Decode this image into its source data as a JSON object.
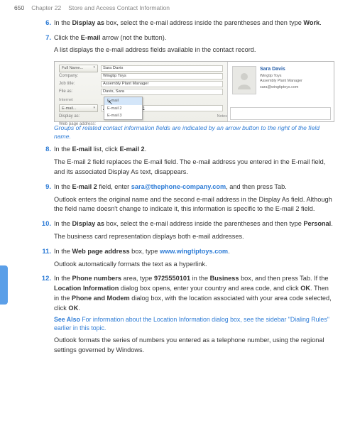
{
  "header": {
    "page": "650",
    "chapter": "Chapter 22",
    "title": "Store and Access Contact Information"
  },
  "steps": {
    "s6": {
      "num": "6.",
      "p1a": "In the ",
      "p1b": "Display as",
      "p1c": " box, select the e-mail address inside the parentheses and then type ",
      "p1d": "Work",
      "p1e": "."
    },
    "s7": {
      "num": "7.",
      "p1a": "Click the ",
      "p1b": "E-mail",
      "p1c": " arrow (not the button).",
      "p2": "A list displays the e-mail address fields available in the contact record."
    },
    "s8": {
      "num": "8.",
      "p1a": "In the ",
      "p1b": "E-mail",
      "p1c": " list, click ",
      "p1d": "E-mail 2",
      "p1e": ".",
      "p2": "The E-mail 2 field replaces the E-mail field. The e-mail address you entered in the E-mail field, and its associated Display As text, disappears."
    },
    "s9": {
      "num": "9.",
      "p1a": "In the ",
      "p1b": "E-mail 2",
      "p1c": " field, enter ",
      "p1d": "sara@thephone-company.com",
      "p1e": ", and then press Tab.",
      "p2": "Outlook enters the original name and the second e-mail address in the Display As field. Although the field name doesn't change to indicate it, this information is specific to the E-mail 2 field."
    },
    "s10": {
      "num": "10.",
      "p1a": "In the ",
      "p1b": "Display as",
      "p1c": " box, select the e-mail address inside the parentheses and then type ",
      "p1d": "Personal",
      "p1e": ".",
      "p2": "The business card representation displays both e-mail addresses."
    },
    "s11": {
      "num": "11.",
      "p1a": "In the ",
      "p1b": "Web page address",
      "p1c": " box, type ",
      "p1d": "www.wingtiptoys.com",
      "p1e": ".",
      "p2": "Outlook automatically formats the text as a hyperlink."
    },
    "s12": {
      "num": "12.",
      "p1a": "In the ",
      "p1b": "Phone numbers",
      "p1c": " area, type ",
      "p1d": "9725550101",
      "p1e": " in the ",
      "p1f": "Business",
      "p1g": " box, and then press Tab. If the ",
      "p1h": "Location Information",
      "p1i": " dialog box opens, enter your country and area code, and click ",
      "p1j": "OK",
      "p1k": ". Then in the ",
      "p1l": "Phone and Modem",
      "p1m": " dialog box, with the location associated with your area code selected, click ",
      "p1n": "OK",
      "p1o": ".",
      "seealso_label": "See Also",
      "seealso_text": "  For information about the Location Information dialog box, see the sidebar \"Dialing Rules\" earlier in this topic.",
      "p3": "Outlook formats the series of numbers you entered as a telephone number, using the regional settings governed by Windows."
    }
  },
  "caption": "Groups of related contact information fields are indicated by an arrow button to the right of the field name.",
  "figure": {
    "btn_fullname": "Full Name...",
    "val_fullname": "Sara Davis",
    "lbl_company": "Company:",
    "val_company": "Wingtip Toys",
    "lbl_jobtitle": "Job title:",
    "val_jobtitle": "Assembly Plant Manager",
    "lbl_fileas": "File as:",
    "val_fileas": "Davis, Sara",
    "section_internet": "Internet",
    "btn_email": "E-mail...",
    "val_email": "sara@wingtiptoys.com",
    "lbl_displayas": "Display as:",
    "lbl_webpage": "Web page address:",
    "dd_opt1": "E-mail",
    "dd_opt2": "E-mail 2",
    "dd_opt3": "E-mail 3",
    "card_name": "Sara Davis",
    "card_company": "Wingtip Toys",
    "card_title": "Assembly Plant Manager",
    "card_email": "sara@wingtiptoys.com",
    "notes_label": "Notes"
  }
}
